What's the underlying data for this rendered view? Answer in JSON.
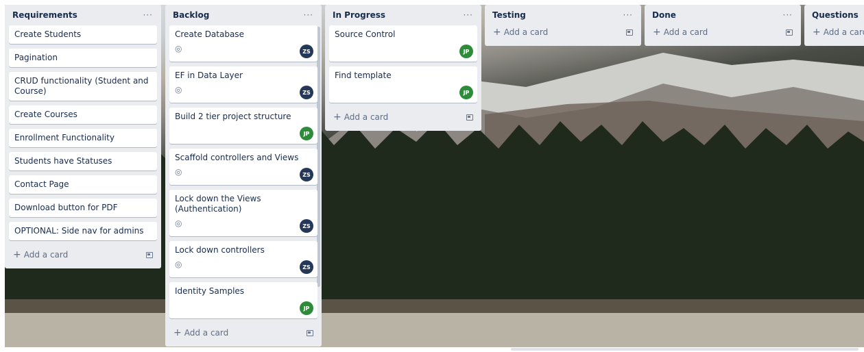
{
  "lists": [
    {
      "title": "Requirements",
      "cards": [
        {
          "text": "Create Students"
        },
        {
          "text": "Pagination"
        },
        {
          "text": "CRUD functionality (Student and Course)"
        },
        {
          "text": "Create Courses"
        },
        {
          "text": "Enrollment Functionality"
        },
        {
          "text": "Students have Statuses"
        },
        {
          "text": "Contact Page"
        },
        {
          "text": "Download button for PDF"
        },
        {
          "text": "OPTIONAL: Side nav for admins"
        }
      ],
      "add_label": "Add a card"
    },
    {
      "title": "Backlog",
      "cards": [
        {
          "text": "Create Database",
          "watch": true,
          "member": "ZS"
        },
        {
          "text": "EF in Data Layer",
          "watch": true,
          "member": "ZS"
        },
        {
          "text": "Build 2 tier project structure",
          "watch": false,
          "member": "JP"
        },
        {
          "text": "Scaffold controllers and Views",
          "watch": true,
          "member": "ZS"
        },
        {
          "text": "Lock down the Views (Authentication)",
          "watch": true,
          "member": "ZS"
        },
        {
          "text": "Lock down controllers",
          "watch": true,
          "member": "ZS"
        },
        {
          "text": "Identity Samples",
          "watch": false,
          "member": "JP"
        }
      ],
      "add_label": "Add a card"
    },
    {
      "title": "In Progress",
      "cards": [
        {
          "text": "Source Control",
          "member": "JP"
        },
        {
          "text": "Find template",
          "member": "JP"
        }
      ],
      "add_label": "Add a card"
    },
    {
      "title": "Testing",
      "cards": [],
      "add_label": "Add a card"
    },
    {
      "title": "Done",
      "cards": [],
      "add_label": "Add a card"
    },
    {
      "title": "Questions",
      "cards": [],
      "add_label": "Add a card"
    }
  ],
  "menu_glyph": "···",
  "plus_glyph": "+",
  "eye_glyph": "◎",
  "colors": {
    "list_bg": "#ebecf0",
    "avatar_zs": "#253858",
    "avatar_jp": "#2e8b3a"
  }
}
